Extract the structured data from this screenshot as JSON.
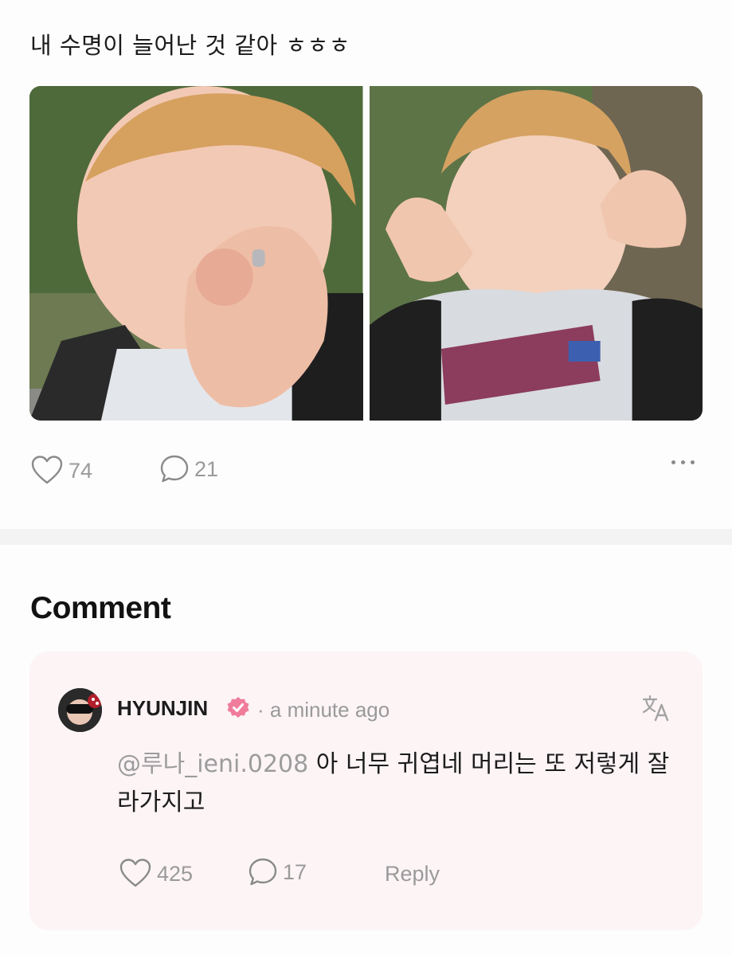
{
  "post": {
    "text": "내 수명이 늘어난 것 같아 ㅎㅎㅎ",
    "likes": "74",
    "comments": "21"
  },
  "comments_section": {
    "title": "Comment"
  },
  "comment": {
    "author": "HYUNJIN",
    "time": "· a minute ago",
    "mention": "@루나_ieni.0208",
    "text": " 아 너무 귀엽네 머리는 또 저렇게 잘라가지고",
    "likes": "425",
    "replies": "17",
    "reply_label": "Reply"
  },
  "icons": {
    "like": "heart-icon",
    "comment": "speech-bubble-icon",
    "more": "more-dots-icon",
    "verified": "verified-badge-icon",
    "translate": "translate-icon"
  },
  "colors": {
    "verified_badge": "#f07c9c",
    "card_background": "#fdf4f6",
    "muted_text": "#9a9a9a"
  }
}
